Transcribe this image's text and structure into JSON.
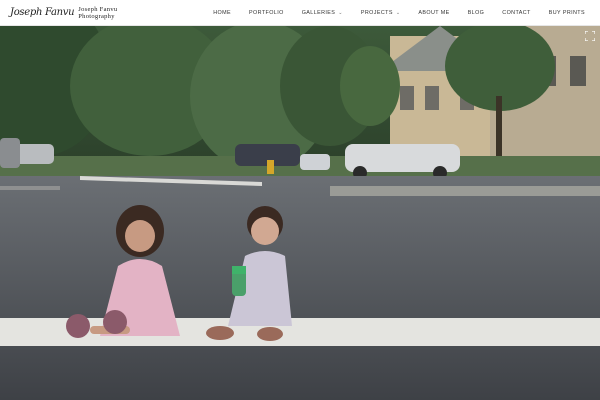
{
  "site": {
    "logo_signature": "Joseph Fanvu",
    "logo_name": "Joseph Fanvu",
    "logo_sub": "Photography"
  },
  "nav": {
    "items": [
      {
        "label": "HOME",
        "dropdown": false
      },
      {
        "label": "PORTFOLIO",
        "dropdown": false
      },
      {
        "label": "GALLERIES",
        "dropdown": true
      },
      {
        "label": "PROJECTS",
        "dropdown": true
      },
      {
        "label": "ABOUT ME",
        "dropdown": false
      },
      {
        "label": "BLOG",
        "dropdown": false
      },
      {
        "label": "CONTACT",
        "dropdown": false
      },
      {
        "label": "BUY PRINTS",
        "dropdown": false
      }
    ],
    "caret_glyph": "⌄"
  },
  "hero": {
    "icons": {
      "fullscreen": "expand-icon"
    }
  }
}
